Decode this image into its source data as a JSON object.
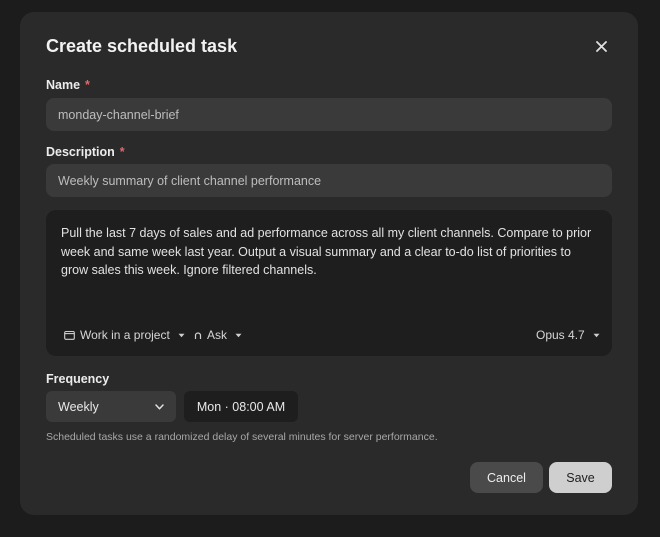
{
  "dialog": {
    "title": "Create scheduled task",
    "close_icon": "close-icon"
  },
  "name": {
    "label": "Name",
    "required_mark": "*",
    "value": "monday-channel-brief"
  },
  "description": {
    "label": "Description",
    "required_mark": "*",
    "value": "Weekly summary of client channel performance"
  },
  "prompt": {
    "text": "Pull the last 7 days of sales and ad performance across all my client channels. Compare to prior week and same week last year. Output a visual summary and a clear to-do list of priorities to grow sales this week. Ignore filtered channels.",
    "project_label": "Work in a project",
    "project_icon": "folder-icon",
    "mode_label": "Ask",
    "mode_icon": "ask-icon",
    "model_label": "Opus 4.7"
  },
  "frequency": {
    "label": "Frequency",
    "selected": "Weekly",
    "time": "Mon · 08:00 AM"
  },
  "note": "Scheduled tasks use a randomized delay of several minutes for server performance.",
  "actions": {
    "cancel": "Cancel",
    "save": "Save"
  },
  "colors": {
    "background": "#1c1c1c",
    "dialog": "#2a2a2a",
    "field": "#3a3a3a",
    "required": "#e0686b",
    "save_button": "#cfcfcf"
  }
}
